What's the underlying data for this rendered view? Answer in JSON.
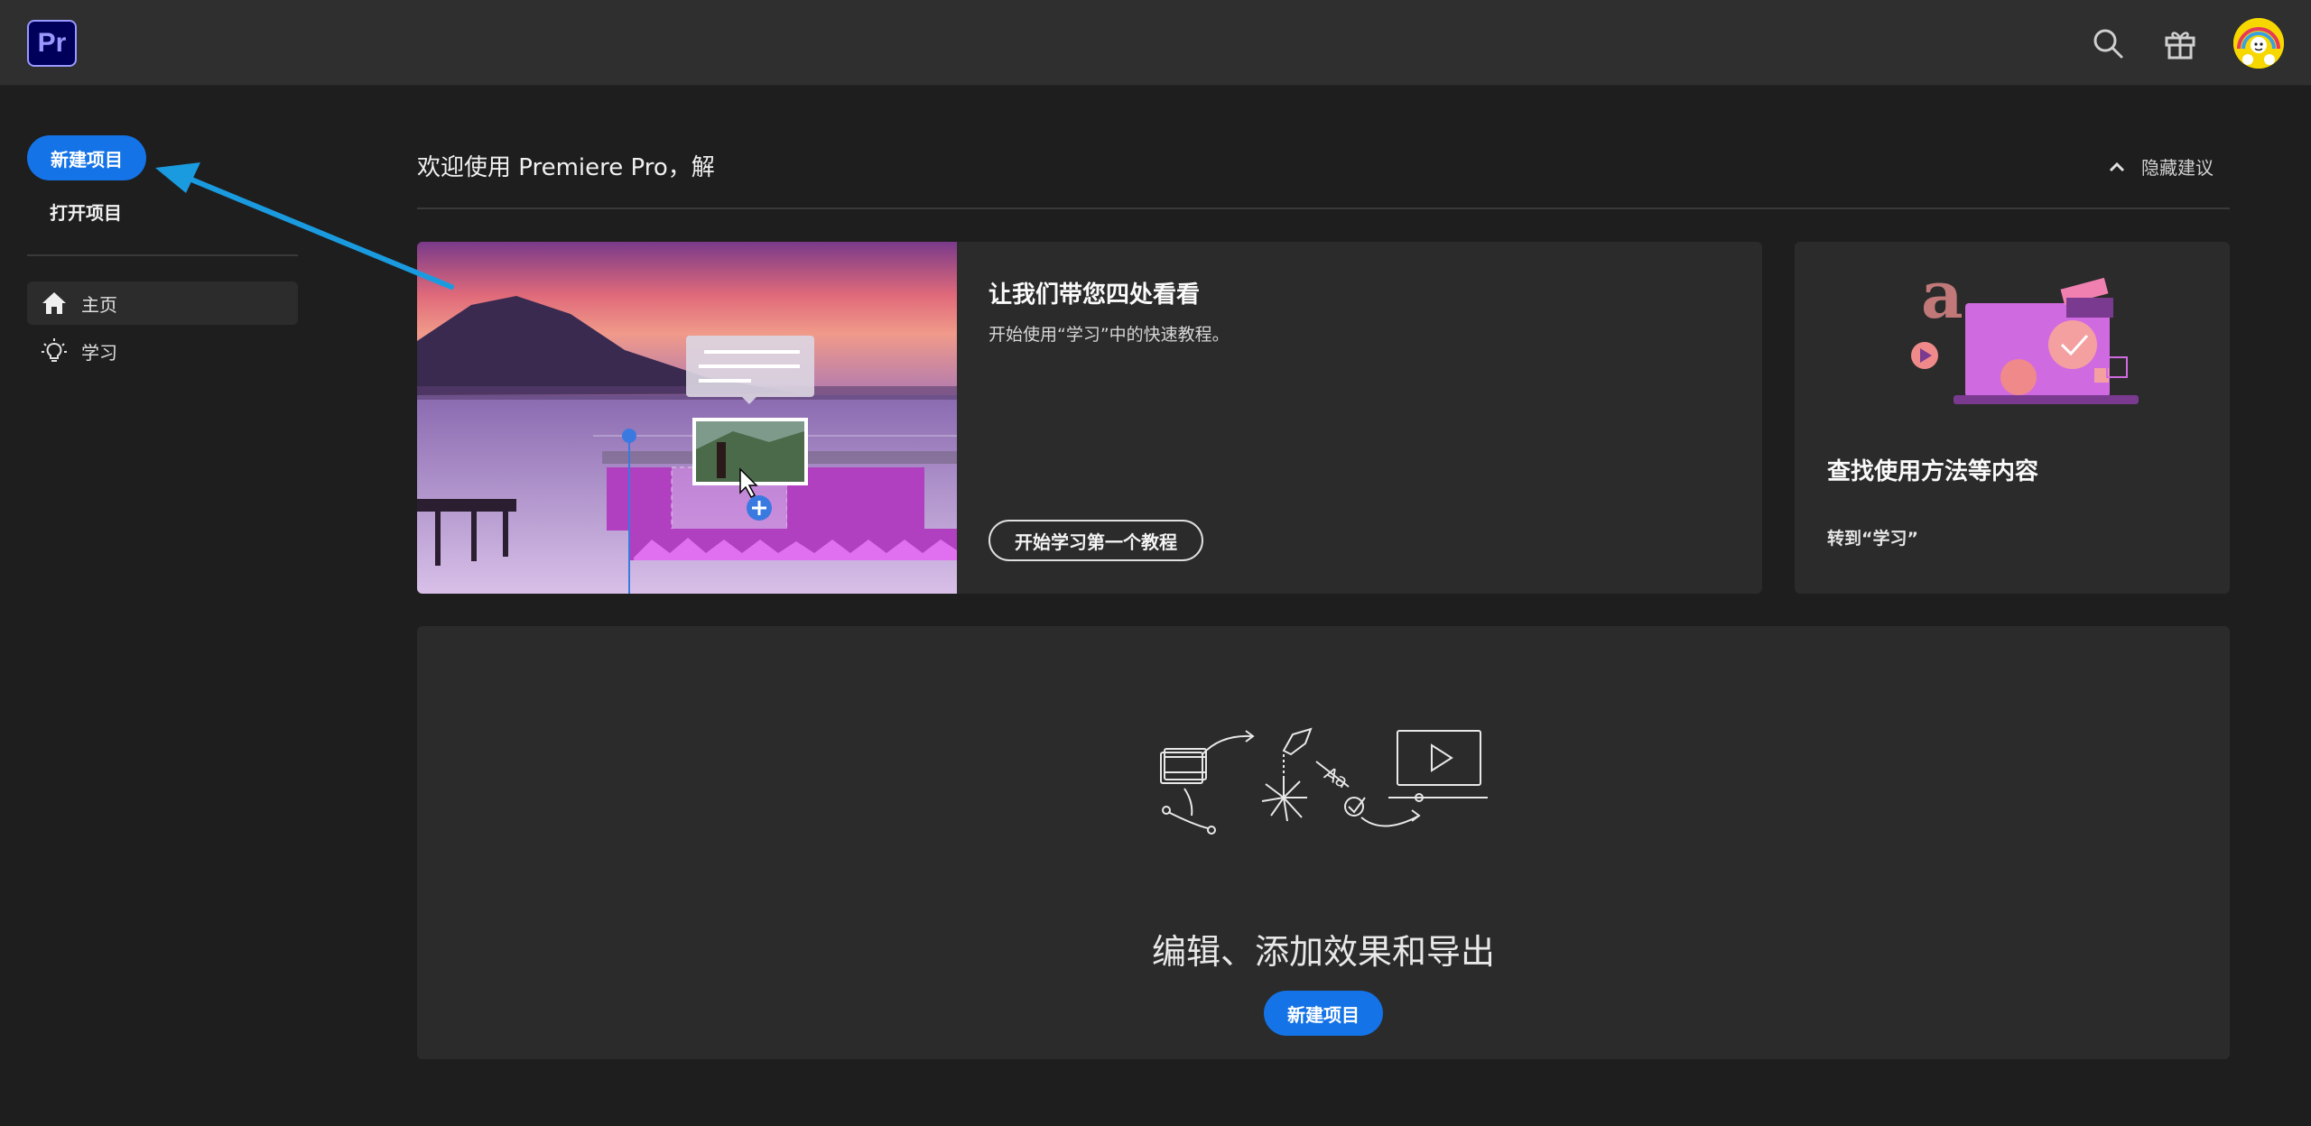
{
  "topbar": {
    "app_logo": "Pr",
    "icons": [
      "search-icon",
      "gift-icon",
      "user-avatar"
    ]
  },
  "sidebar": {
    "new_project": "新建项目",
    "open_project": "打开项目",
    "nav": [
      {
        "label": "主页",
        "icon": "home-icon",
        "active": true
      },
      {
        "label": "学习",
        "icon": "lightbulb-icon",
        "active": false
      }
    ]
  },
  "main": {
    "welcome": "欢迎使用 Premiere Pro，解",
    "hide_suggestions": "隐藏建议",
    "tour_card": {
      "title": "让我们带您四处看看",
      "subtitle": "开始使用“学习”中的快速教程。",
      "button": "开始学习第一个教程"
    },
    "learn_card": {
      "title": "查找使用方法等内容",
      "link": "转到“学习”"
    },
    "edit_card": {
      "title": "编辑、添加效果和导出",
      "button": "新建项目"
    }
  },
  "colors": {
    "accent": "#1473e6",
    "annotation_arrow": "#1a9be0",
    "premiere_purple": "#9999ff"
  }
}
